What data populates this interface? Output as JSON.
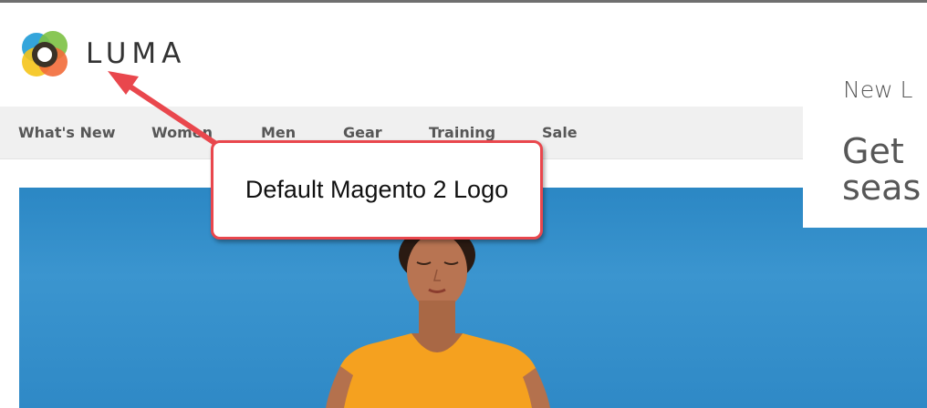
{
  "logo": {
    "brand": "LUMA",
    "mark_colors": [
      "#4fa3df",
      "#7cc142",
      "#f5a623",
      "#f26b3a",
      "#2e2a25"
    ]
  },
  "nav": {
    "items": [
      {
        "label": "What's New"
      },
      {
        "label": "Women"
      },
      {
        "label": "Men"
      },
      {
        "label": "Gear"
      },
      {
        "label": "Training"
      },
      {
        "label": "Sale"
      }
    ]
  },
  "hero": {
    "subtitle": "New L",
    "title_line1": "Get",
    "title_line2": "seas"
  },
  "annotation": {
    "label": "Default Magento 2 Logo",
    "color": "#e9474d"
  }
}
